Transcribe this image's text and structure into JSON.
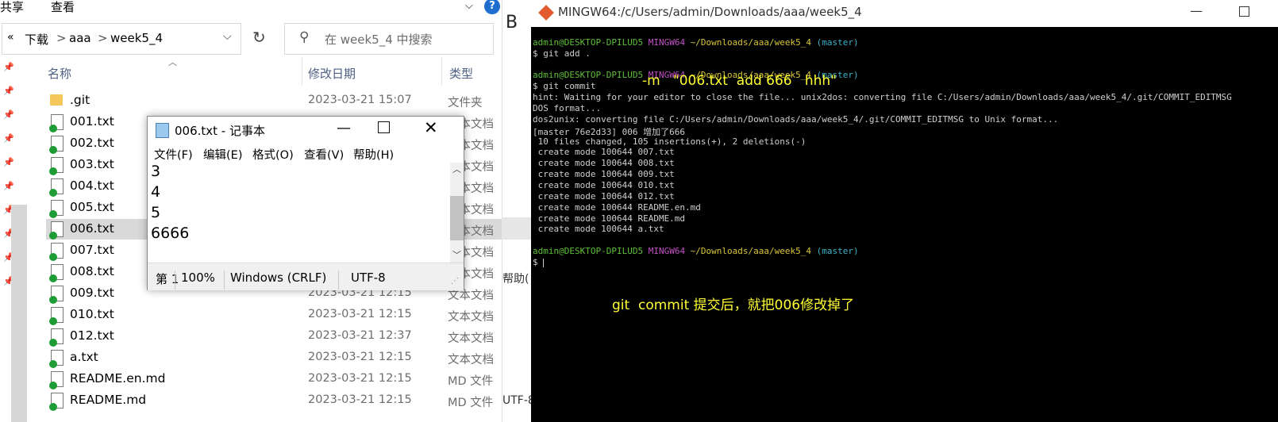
{
  "explorer": {
    "ribbon": {
      "share": "共享",
      "view": "查看",
      "help_glyph": "?"
    },
    "breadcrumb": {
      "back_glyph": "«",
      "items": [
        "下载",
        "aaa",
        "week5_4"
      ],
      "sep": ">"
    },
    "search_placeholder": "在 week5_4 中搜索",
    "columns": {
      "name": "名称",
      "date": "修改日期",
      "type": "类型"
    },
    "files": [
      {
        "name": ".git",
        "date": "2023-03-21 15:07",
        "type": "文件夹"
      },
      {
        "name": "001.txt",
        "date": "",
        "type": "文本文档"
      },
      {
        "name": "002.txt",
        "date": "",
        "type": "文本文档"
      },
      {
        "name": "003.txt",
        "date": "",
        "type": "文本文档"
      },
      {
        "name": "004.txt",
        "date": "",
        "type": "文本文档"
      },
      {
        "name": "005.txt",
        "date": "",
        "type": "文本文档"
      },
      {
        "name": "006.txt",
        "date": "",
        "type": "文本文档"
      },
      {
        "name": "007.txt",
        "date": "",
        "type": "文本文档"
      },
      {
        "name": "008.txt",
        "date": "",
        "type": "文本文档"
      },
      {
        "name": "009.txt",
        "date": "2023-03-21 12:15",
        "type": "文本文档"
      },
      {
        "name": "010.txt",
        "date": "2023-03-21 12:15",
        "type": "文本文档"
      },
      {
        "name": "012.txt",
        "date": "2023-03-21 12:37",
        "type": "文本文档"
      },
      {
        "name": "a.txt",
        "date": "2023-03-21 12:15",
        "type": "文本文档"
      },
      {
        "name": "README.en.md",
        "date": "2023-03-21 12:15",
        "type": "MD 文件"
      },
      {
        "name": "README.md",
        "date": "2023-03-21 12:15",
        "type": "MD 文件"
      }
    ]
  },
  "notepad": {
    "title": "006.txt - 记事本",
    "menu": [
      "文件(F)",
      "编辑(E)",
      "格式(O)",
      "查看(V)",
      "帮助(H)"
    ],
    "lines": [
      "3",
      "4",
      "5",
      "6666"
    ],
    "status": {
      "pos": "第 1",
      "zoom": "100%",
      "eol": "Windows (CRLF)",
      "enc": "UTF-8"
    }
  },
  "background": {
    "b_glyph": "B",
    "help_fragment": "帮助(",
    "utf_fragment": "UTF-8"
  },
  "terminal": {
    "title": "MINGW64:/c/Users/admin/Downloads/aaa/week5_4",
    "prompt_user": "admin@DESKTOP-DPILUD5",
    "prompt_sys": "MINGW64",
    "prompt_path": "~/Downloads/aaa/week5_4",
    "prompt_branch": "(master)",
    "cmd1": "$ git add .",
    "cmd2": "$ git commit",
    "lines": [
      "hint: Waiting for your editor to close the file... unix2dos: converting file C:/Users/admin/Downloads/aaa/week5_4/.git/COMMIT_EDITMSG",
      "DOS format...",
      "dos2unix: converting file C:/Users/admin/Downloads/aaa/week5_4/.git/COMMIT_EDITMSG to Unix format...",
      "[master 76e2d33] 006 增加了666",
      " 10 files changed, 105 insertions(+), 2 deletions(-)",
      " create mode 100644 007.txt",
      " create mode 100644 008.txt",
      " create mode 100644 009.txt",
      " create mode 100644 010.txt",
      " create mode 100644 012.txt",
      " create mode 100644 README.en.md",
      " create mode 100644 README.md",
      " create mode 100644 a.txt"
    ],
    "last_prompt": "$",
    "annotation_cmd": "-m   \"006.txt  add 666   hhh\"",
    "annotation_note": "git  commit 提交后，就把006修改掉了"
  }
}
